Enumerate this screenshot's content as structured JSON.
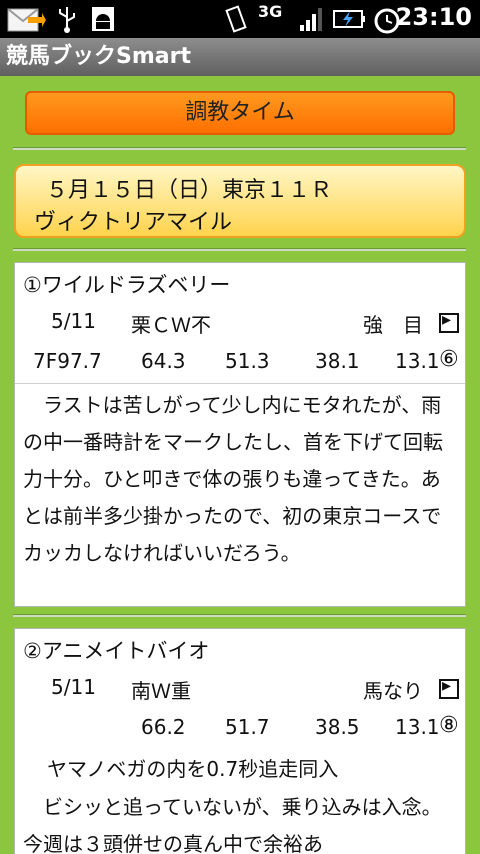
{
  "status": {
    "time": "23:10",
    "network": "3G"
  },
  "app": {
    "title": "競馬ブックSmart"
  },
  "header_button": "調教タイム",
  "race": {
    "line1": "５月１５日（日）東京１１Ｒ",
    "line2": "ヴィクトリアマイル"
  },
  "horses": [
    {
      "name": "①ワイルドラズベリー",
      "date": "5/11",
      "course": "栗ＣＷ不",
      "strength": "強　目",
      "times": [
        "7F97.7",
        "64.3",
        "51.3",
        "38.1",
        "13.1"
      ],
      "position": "⑥",
      "comment": "　ラストは苦しがって少し内にモタれたが、雨の中一番時計をマークしたし、首を下げて回転力十分。ひと叩きで体の張りも違ってきた。あとは前半多少掛かったので、初の東京コースでカッカしなければいいだろう。"
    },
    {
      "name": "②アニメイトバイオ",
      "date": "5/11",
      "course": "南Ｗ重",
      "strength": "馬なり",
      "times": [
        "",
        "66.2",
        "51.7",
        "38.5",
        "13.1"
      ],
      "position": "⑧",
      "note": "ヤマノベガの内を0.7秒追走同入",
      "comment": "　ビシッと追っていないが、乗り込みは入念。今週は３頭併せの真ん中で余裕あ"
    }
  ]
}
